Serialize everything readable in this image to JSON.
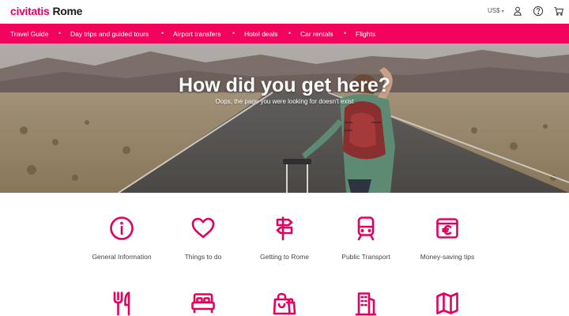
{
  "header": {
    "brand": "civitatis",
    "city": "Rome",
    "currency": "US$",
    "currency_caret": "▾",
    "icons": [
      "user-icon",
      "help-icon",
      "cart-icon"
    ]
  },
  "nav": {
    "items": [
      {
        "label": "Travel Guide"
      },
      {
        "label": "Day trips and guided tours"
      },
      {
        "label": "Airport transfers"
      },
      {
        "label": "Hotel deals"
      },
      {
        "label": "Car rentals"
      },
      {
        "label": "Flights"
      }
    ],
    "separator": "•"
  },
  "hero": {
    "title": "How did you get here?",
    "subtitle": "Oops, the page you were looking for doesn't exist"
  },
  "categories": [
    {
      "label": "General Information",
      "icon": "info-icon"
    },
    {
      "label": "Things to do",
      "icon": "heart-icon"
    },
    {
      "label": "Getting to Rome",
      "icon": "signpost-icon"
    },
    {
      "label": "Public Transport",
      "icon": "train-icon"
    },
    {
      "label": "Money-saving tips",
      "icon": "wallet-euro-icon"
    },
    {
      "label": "",
      "icon": "fork-knife-icon"
    },
    {
      "label": "",
      "icon": "bed-icon"
    },
    {
      "label": "",
      "icon": "shopping-bag-icon"
    },
    {
      "label": "",
      "icon": "building-icon"
    },
    {
      "label": "",
      "icon": "map-icon"
    }
  ],
  "colors": {
    "brand": "#e6005e",
    "nav_bg": "#f2045d",
    "icon": "#e6005e"
  }
}
